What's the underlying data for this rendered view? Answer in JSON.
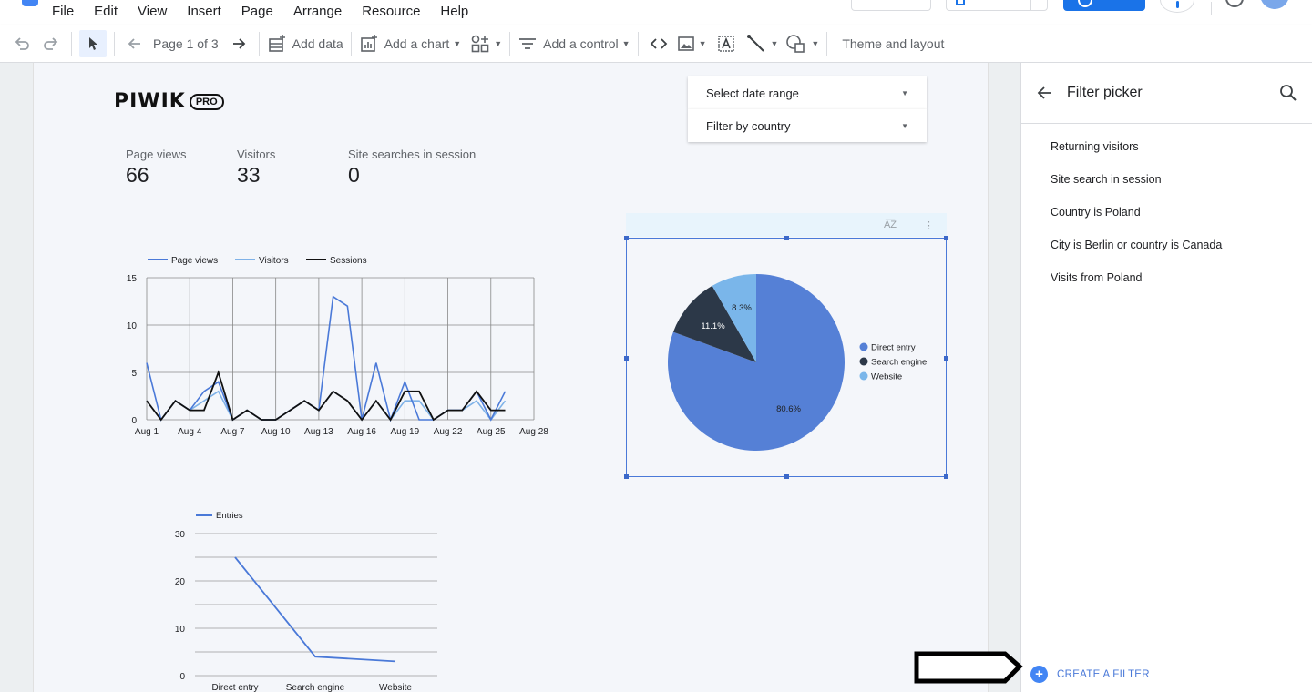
{
  "menu": [
    "File",
    "Edit",
    "View",
    "Insert",
    "Page",
    "Arrange",
    "Resource",
    "Help"
  ],
  "toolbar": {
    "page_indicator": "Page 1 of 3",
    "add_data": "Add data",
    "add_chart": "Add a chart",
    "add_control": "Add a control",
    "theme_layout": "Theme and layout"
  },
  "report": {
    "logo_text": "PIWIK",
    "logo_badge": "PRO",
    "kpis": [
      {
        "label": "Page views",
        "value": "66"
      },
      {
        "label": "Visitors",
        "value": "33"
      },
      {
        "label": "Site searches in session",
        "value": "0"
      }
    ],
    "controls": {
      "date_range": "Select date range",
      "country_filter": "Filter by country"
    },
    "pie_header_sort": "A͞Z",
    "pie_header_more": "⋮"
  },
  "colors": {
    "page_views": "#4a79d8",
    "visitors": "#7fb2e8",
    "sessions": "#111111",
    "direct_entry": "#5580d6",
    "search_engine": "#2c3848",
    "website": "#7ab6ea",
    "accent": "#1a73e8"
  },
  "chart_data": [
    {
      "type": "line",
      "x": [
        "Aug 1",
        "Aug 2",
        "Aug 3",
        "Aug 4",
        "Aug 5",
        "Aug 6",
        "Aug 7",
        "Aug 8",
        "Aug 9",
        "Aug 10",
        "Aug 11",
        "Aug 12",
        "Aug 13",
        "Aug 14",
        "Aug 15",
        "Aug 16",
        "Aug 17",
        "Aug 18",
        "Aug 19",
        "Aug 20",
        "Aug 21",
        "Aug 22",
        "Aug 23",
        "Aug 24",
        "Aug 25",
        "Aug 26",
        "Aug 27"
      ],
      "x_ticks": [
        "Aug 1",
        "Aug 4",
        "Aug 7",
        "Aug 10",
        "Aug 13",
        "Aug 16",
        "Aug 19",
        "Aug 22",
        "Aug 25",
        "Aug 28"
      ],
      "y_ticks": [
        0,
        5,
        10,
        15
      ],
      "ylim": [
        0,
        15
      ],
      "grid": true,
      "legend_position": "top",
      "series": [
        {
          "name": "Page views",
          "values": [
            6,
            0,
            2,
            1,
            3,
            4,
            0,
            1,
            0,
            0,
            1,
            2,
            1,
            13,
            12,
            0,
            6,
            0,
            4,
            0,
            0,
            1,
            1,
            3,
            0,
            3,
            null
          ]
        },
        {
          "name": "Visitors",
          "values": [
            2,
            0,
            2,
            1,
            2,
            3,
            0,
            1,
            0,
            0,
            1,
            2,
            1,
            3,
            2,
            0,
            2,
            0,
            2,
            2,
            0,
            1,
            1,
            2,
            0,
            2,
            null
          ]
        },
        {
          "name": "Sessions",
          "values": [
            2,
            0,
            2,
            1,
            1,
            5,
            0,
            1,
            0,
            0,
            1,
            2,
            1,
            3,
            2,
            0,
            2,
            0,
            3,
            3,
            0,
            1,
            1,
            3,
            1,
            1,
            null
          ]
        }
      ]
    },
    {
      "type": "pie",
      "legend_position": "right",
      "labels": [
        "Direct entry",
        "Search engine",
        "Website"
      ],
      "values": [
        80.6,
        11.1,
        8.3
      ],
      "value_labels": [
        "80.6%",
        "11.1%",
        "8.3%"
      ]
    },
    {
      "type": "line",
      "categories": [
        "Direct entry",
        "Search engine",
        "Website"
      ],
      "y_ticks": [
        0,
        10,
        20,
        30
      ],
      "ylim": [
        0,
        30
      ],
      "grid": true,
      "legend_position": "top",
      "series": [
        {
          "name": "Entries",
          "values": [
            25,
            4,
            3
          ]
        }
      ]
    }
  ],
  "filter_picker": {
    "title": "Filter picker",
    "items": [
      "Returning visitors",
      "Site search in session",
      "Country is Poland",
      "City is Berlin or country is Canada",
      "Visits from Poland"
    ],
    "create_label": "CREATE A FILTER",
    "create_symbol": "+"
  }
}
